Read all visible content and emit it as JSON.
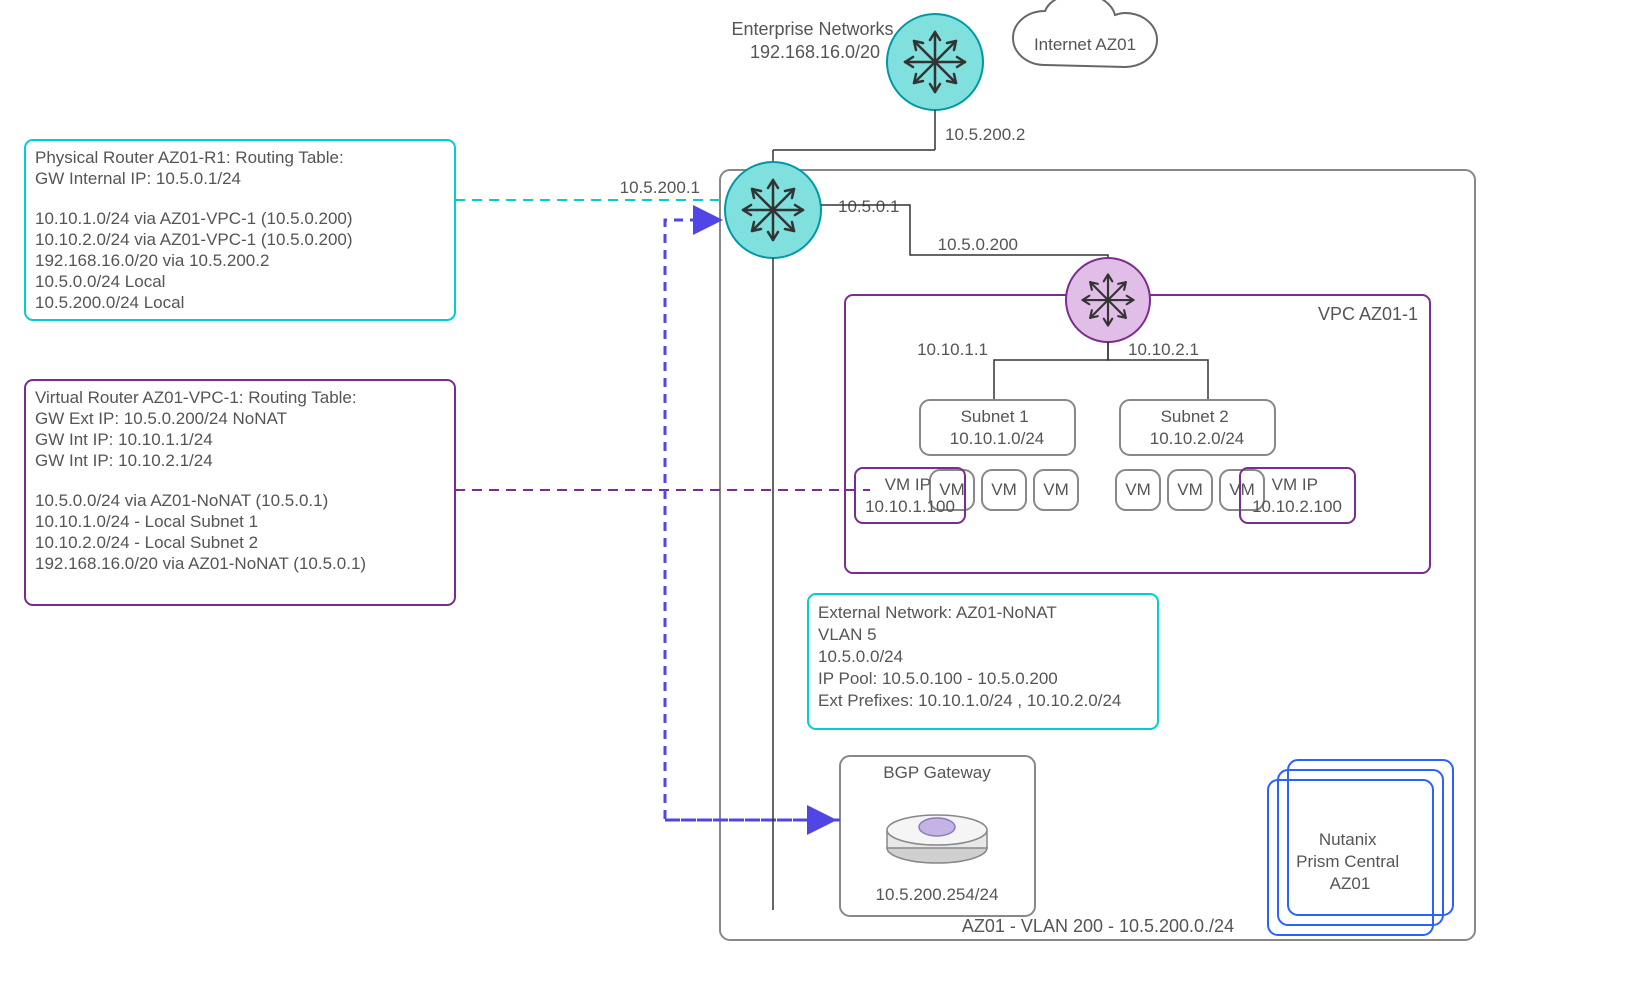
{
  "top": {
    "enterprise_label": "Enterprise Networks",
    "enterprise_cidr": "192.168.16.0/20",
    "internet_label": "Internet AZ01",
    "enterprise_link_ip": "10.5.200.2"
  },
  "physical_router_box": {
    "title": "Physical Router AZ01-R1: Routing Table:",
    "gw": "GW Internal IP: 10.5.0.1/24",
    "r1": "10.10.1.0/24 via AZ01-VPC-1 (10.5.0.200)",
    "r2": "10.10.2.0/24 via AZ01-VPC-1 (10.5.0.200)",
    "r3": "192.168.16.0/20 via 10.5.200.2",
    "r4": "10.5.0.0/24 Local",
    "r5": "10.5.200.0/24 Local"
  },
  "virtual_router_box": {
    "title": "Virtual Router AZ01-VPC-1: Routing Table:",
    "g1": "GW Ext IP: 10.5.0.200/24 NoNAT",
    "g2": "GW Int IP: 10.10.1.1/24",
    "g3": "GW Int IP: 10.10.2.1/24",
    "r1": "10.5.0.0/24 via AZ01-NoNAT (10.5.0.1)",
    "r2": "10.10.1.0/24 - Local Subnet 1",
    "r3": "10.10.2.0/24 - Local Subnet 2",
    "r4": "192.168.16.0/20 via AZ01-NoNAT (10.5.0.1)"
  },
  "phys_router": {
    "wan_ip": "10.5.200.1",
    "lan_ip": "10.5.0.1"
  },
  "vpc": {
    "title": "VPC AZ01-1",
    "router_ip": "10.5.0.200",
    "sub1_gw": "10.10.1.1",
    "sub2_gw": "10.10.2.1",
    "subnet1_name": "Subnet 1",
    "subnet1_cidr": "10.10.1.0/24",
    "subnet2_name": "Subnet 2",
    "subnet2_cidr": "10.10.2.0/24",
    "vm_label": "VM",
    "vm1_ip_l1": "VM IP",
    "vm1_ip_l2": "10.10.1.100",
    "vm2_ip_l1": "VM IP",
    "vm2_ip_l2": "10.10.2.100"
  },
  "extnet": {
    "l1": "External Network: AZ01-NoNAT",
    "l2": "VLAN 5",
    "l3": "10.5.0.0/24",
    "l4": "IP Pool: 10.5.0.100 - 10.5.0.200",
    "l5": "Ext Prefixes: 10.10.1.0/24 , 10.10.2.0/24"
  },
  "bgp": {
    "title": "BGP Gateway",
    "ip": "10.5.200.254/24"
  },
  "prism": {
    "l1": "Nutanix",
    "l2": "Prism Central",
    "l3": "AZ01"
  },
  "az_footer": "AZ01 - VLAN 200 - 10.5.200.0./24"
}
